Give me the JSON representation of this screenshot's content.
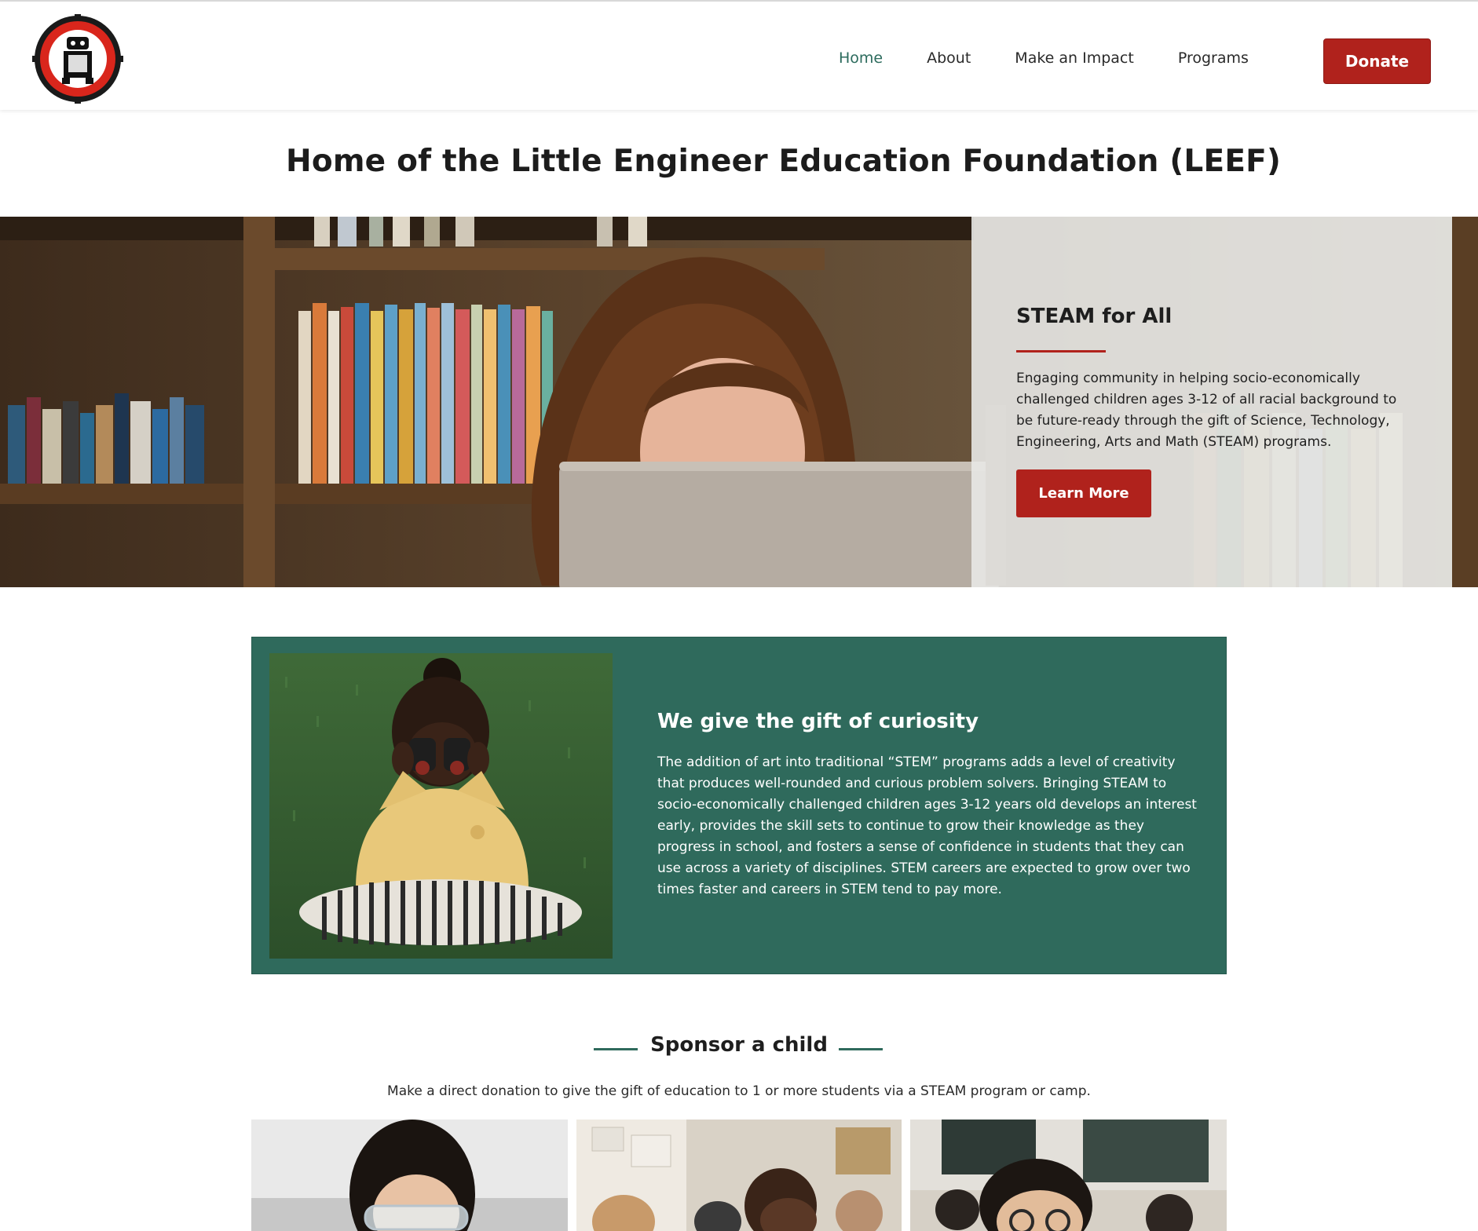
{
  "header": {
    "logo_alt": "Little Engineers logo",
    "nav": [
      {
        "label": "Home",
        "active": true
      },
      {
        "label": "About",
        "active": false
      },
      {
        "label": "Make an Impact",
        "active": false
      },
      {
        "label": "Programs",
        "active": false
      }
    ],
    "donate_label": "Donate"
  },
  "page_title": "Home of the Little Engineer Education Foundation (LEEF)",
  "hero": {
    "heading": "STEAM for All",
    "text": "Engaging community in helping socio-economically challenged children ages 3-12 of all racial background to be future-ready through the gift of Science, Technology, Engineering, Arts and Math (STEAM) programs.",
    "button_label": "Learn More"
  },
  "gift": {
    "heading": "We give the gift of curiosity",
    "text": "The addition of art into traditional “STEM” programs adds a level of creativity that produces well-rounded and curious problem solvers. Bringing STEAM to socio-economically challenged children ages 3-12 years old develops an interest early, provides the skill sets to continue to grow their knowledge as they progress in school, and  fosters a sense of confidence in students that they can use across a variety of disciplines. STEM careers are expected to grow over two times faster and careers in STEM tend to pay more."
  },
  "sponsor": {
    "title": "Sponsor a child",
    "subtitle": "Make a direct donation to give the gift of education to 1 or more students via a STEAM program or camp."
  },
  "colors": {
    "brand_red": "#b0221c",
    "brand_green": "#2f6a5c",
    "nav_active": "#2c6b5d"
  }
}
